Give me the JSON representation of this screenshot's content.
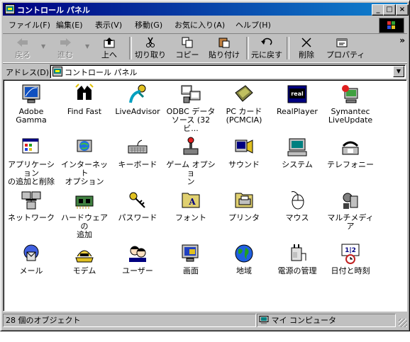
{
  "window": {
    "title": "コントロール パネル"
  },
  "menu": [
    "ファイル(F)",
    "編集(E)",
    "表示(V)",
    "移動(G)",
    "お気に入り(A)",
    "ヘルプ(H)"
  ],
  "toolbar": {
    "back": "戻る",
    "forward": "進む",
    "up": "上へ",
    "cut": "切り取り",
    "copy": "コピー",
    "paste": "貼り付け",
    "undo": "元に戻す",
    "delete": "削除",
    "properties": "プロパティ"
  },
  "address": {
    "label": "アドレス(D)",
    "value": "コントロール パネル"
  },
  "items": [
    {
      "l1": "Adobe",
      "l2": "Gamma",
      "icon": "adobe-gamma-icon"
    },
    {
      "l1": "Find Fast",
      "l2": "",
      "icon": "find-fast-icon"
    },
    {
      "l1": "LiveAdvisor",
      "l2": "",
      "icon": "liveadvisor-icon"
    },
    {
      "l1": "ODBC データ",
      "l2": "ソース (32ビ...",
      "icon": "odbc-icon"
    },
    {
      "l1": "PC カード",
      "l2": "(PCMCIA)",
      "icon": "pc-card-icon"
    },
    {
      "l1": "RealPlayer",
      "l2": "",
      "icon": "realplayer-icon"
    },
    {
      "l1": "Symantec",
      "l2": "LiveUpdate",
      "icon": "symantec-liveupdate-icon"
    },
    {
      "l1": "アプリケーション",
      "l2": "の追加と削除",
      "icon": "add-remove-programs-icon"
    },
    {
      "l1": "インターネット",
      "l2": "オプション",
      "icon": "internet-options-icon"
    },
    {
      "l1": "キーボード",
      "l2": "",
      "icon": "keyboard-icon"
    },
    {
      "l1": "ゲーム オプショ",
      "l2": "ン",
      "icon": "game-options-icon"
    },
    {
      "l1": "サウンド",
      "l2": "",
      "icon": "sound-icon"
    },
    {
      "l1": "システム",
      "l2": "",
      "icon": "system-icon"
    },
    {
      "l1": "テレフォニー",
      "l2": "",
      "icon": "telephony-icon"
    },
    {
      "l1": "ネットワーク",
      "l2": "",
      "icon": "network-icon"
    },
    {
      "l1": "ハードウェアの",
      "l2": "追加",
      "icon": "add-hardware-icon"
    },
    {
      "l1": "パスワード",
      "l2": "",
      "icon": "passwords-icon"
    },
    {
      "l1": "フォント",
      "l2": "",
      "icon": "fonts-icon"
    },
    {
      "l1": "プリンタ",
      "l2": "",
      "icon": "printers-icon"
    },
    {
      "l1": "マウス",
      "l2": "",
      "icon": "mouse-icon"
    },
    {
      "l1": "マルチメディア",
      "l2": "",
      "icon": "multimedia-icon"
    },
    {
      "l1": "メール",
      "l2": "",
      "icon": "mail-icon"
    },
    {
      "l1": "モデム",
      "l2": "",
      "icon": "modem-icon"
    },
    {
      "l1": "ユーザー",
      "l2": "",
      "icon": "users-icon"
    },
    {
      "l1": "画面",
      "l2": "",
      "icon": "display-icon"
    },
    {
      "l1": "地域",
      "l2": "",
      "icon": "regional-settings-icon"
    },
    {
      "l1": "電源の管理",
      "l2": "",
      "icon": "power-management-icon"
    },
    {
      "l1": "日付と時刻",
      "l2": "",
      "icon": "date-time-icon"
    }
  ],
  "status": {
    "count": "28 個のオブジェクト",
    "location": "マイ コンピュータ"
  },
  "colors": {
    "titlebar": "#000080",
    "face": "#c0c0c0"
  }
}
